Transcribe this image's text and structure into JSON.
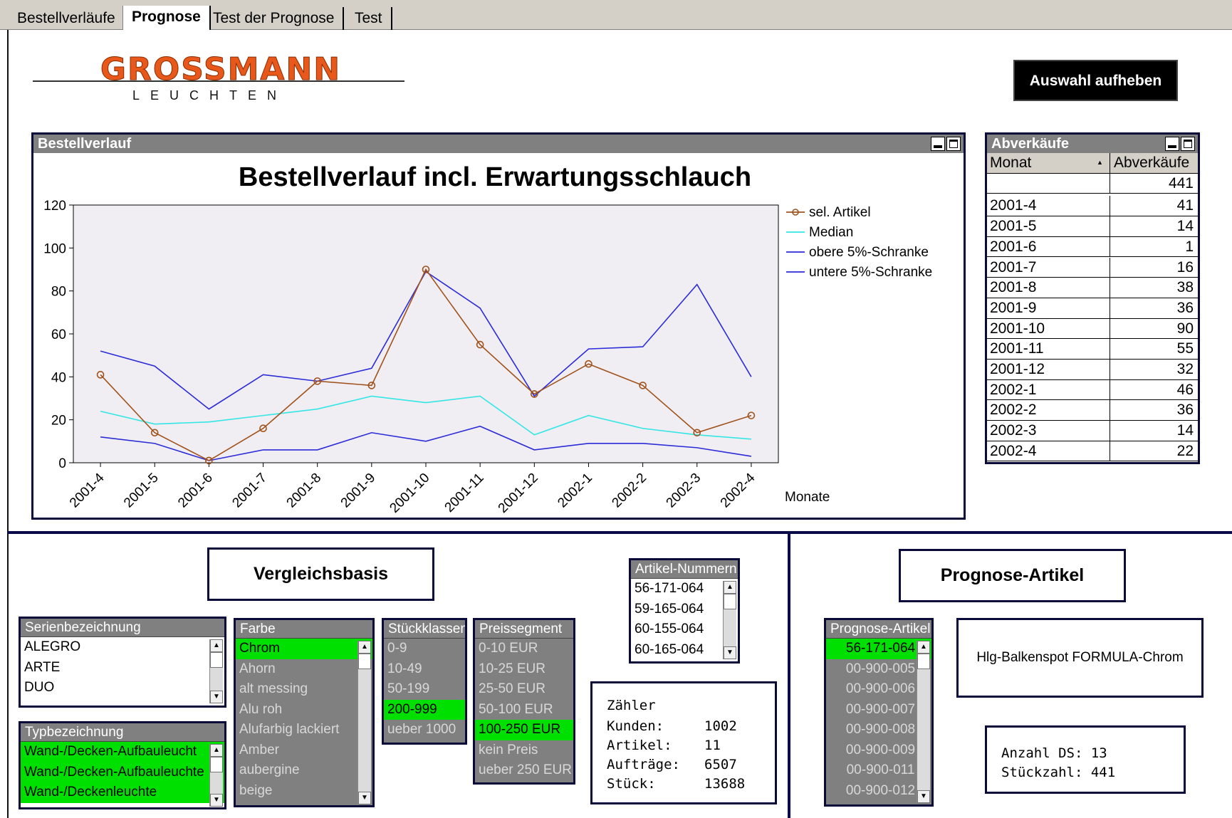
{
  "tabs": [
    {
      "label": "Bestellverläufe",
      "active": false
    },
    {
      "label": "Prognose",
      "active": true
    },
    {
      "label": "Test der Prognose",
      "active": false
    },
    {
      "label": "Test",
      "active": false
    }
  ],
  "logo": {
    "name": "GROSSMANN",
    "sub": "LEUCHTEN"
  },
  "clear_button": "Auswahl aufheben",
  "chart_panel": {
    "title": "Bestellverlauf"
  },
  "chart_data": {
    "type": "line",
    "title": "Bestellverlauf incl. Erwartungsschlauch",
    "xlabel": "Monate",
    "ylabel": "",
    "ylim": [
      0,
      120
    ],
    "yticks": [
      0,
      20,
      40,
      60,
      80,
      100,
      120
    ],
    "categories": [
      "2001-4",
      "2001-5",
      "2001-6",
      "2001-7",
      "2001-8",
      "2001-9",
      "2001-10",
      "2001-11",
      "2001-12",
      "2002-1",
      "2002-2",
      "2002-3",
      "2002-4"
    ],
    "legend_position": "right",
    "series": [
      {
        "name": "sel. Artikel",
        "color": "#a0521c",
        "marker": "circle",
        "values": [
          41,
          14,
          1,
          16,
          38,
          36,
          90,
          55,
          32,
          46,
          36,
          14,
          22
        ]
      },
      {
        "name": "Median",
        "color": "#33e6e6",
        "values": [
          24,
          18,
          19,
          22,
          25,
          31,
          28,
          31,
          13,
          22,
          16,
          13,
          11
        ]
      },
      {
        "name": "obere 5%-Schranke",
        "color": "#2b2bd9",
        "values": [
          52,
          45,
          25,
          41,
          38,
          44,
          89,
          72,
          31,
          53,
          54,
          83,
          40
        ]
      },
      {
        "name": "untere 5%-Schranke",
        "color": "#2b2bd9",
        "values": [
          12,
          9,
          1,
          6,
          6,
          14,
          10,
          17,
          6,
          9,
          9,
          7,
          3
        ]
      }
    ]
  },
  "abverkaeufe": {
    "title": "Abverkäufe",
    "col_month": "Monat",
    "col_value": "Abverkäufe",
    "total": "441",
    "rows": [
      {
        "m": "2001-4",
        "v": "41"
      },
      {
        "m": "2001-5",
        "v": "14"
      },
      {
        "m": "2001-6",
        "v": "1"
      },
      {
        "m": "2001-7",
        "v": "16"
      },
      {
        "m": "2001-8",
        "v": "38"
      },
      {
        "m": "2001-9",
        "v": "36"
      },
      {
        "m": "2001-10",
        "v": "90"
      },
      {
        "m": "2001-11",
        "v": "55"
      },
      {
        "m": "2001-12",
        "v": "32"
      },
      {
        "m": "2002-1",
        "v": "46"
      },
      {
        "m": "2002-2",
        "v": "36"
      },
      {
        "m": "2002-3",
        "v": "14"
      },
      {
        "m": "2002-4",
        "v": "22"
      }
    ]
  },
  "vergleichsbasis": "Vergleichsbasis",
  "prognose_artikel_title": "Prognose-Artikel",
  "serien": {
    "label": "Serienbezeichnung",
    "items": [
      "ALEGRO",
      "ARTE",
      "DUO"
    ]
  },
  "typ": {
    "label": "Typbezeichnung",
    "items": [
      "Wand-/Decken-Aufbauleucht",
      "Wand-/Decken-Aufbauleuchte",
      "Wand-/Deckenleuchte"
    ]
  },
  "farbe": {
    "label": "Farbe",
    "items": [
      "Chrom",
      "Ahorn",
      "alt messing",
      "Alu roh",
      "Alufarbig lackiert",
      "Amber",
      "aubergine",
      "beige"
    ],
    "selected": "Chrom"
  },
  "stueck": {
    "label": "Stückklassen",
    "items": [
      "0-9",
      "10-49",
      "50-199",
      "200-999",
      "ueber 1000"
    ],
    "selected": "200-999"
  },
  "preis": {
    "label": "Preissegment",
    "items": [
      "0-10 EUR",
      "10-25 EUR",
      "25-50 EUR",
      "50-100 EUR",
      "100-250 EUR",
      "kein Preis",
      "ueber 250 EUR"
    ],
    "selected": "100-250 EUR"
  },
  "artikelnr": {
    "label": "Artikel-Nummern",
    "items": [
      "56-171-064",
      "59-165-064",
      "60-155-064",
      "60-165-064"
    ]
  },
  "zaehler": {
    "title": "Zähler",
    "rows": [
      {
        "k": "Kunden:",
        "v": "1002"
      },
      {
        "k": "Artikel:",
        "v": "11"
      },
      {
        "k": "Aufträge:",
        "v": "6507"
      },
      {
        "k": "Stück:",
        "v": "13688"
      }
    ]
  },
  "prognose_list": {
    "label": "Prognose-Artikel",
    "items": [
      "56-171-064",
      "00-900-005",
      "00-900-006",
      "00-900-007",
      "00-900-008",
      "00-900-009",
      "00-900-011",
      "00-900-012"
    ],
    "selected": "56-171-064"
  },
  "article_desc": "Hlg-Balkenspot FORMULA-Chrom",
  "anzahl": {
    "ds_label": "Anzahl DS:",
    "ds": "13",
    "stk_label": "Stückzahl:",
    "stk": "441"
  }
}
